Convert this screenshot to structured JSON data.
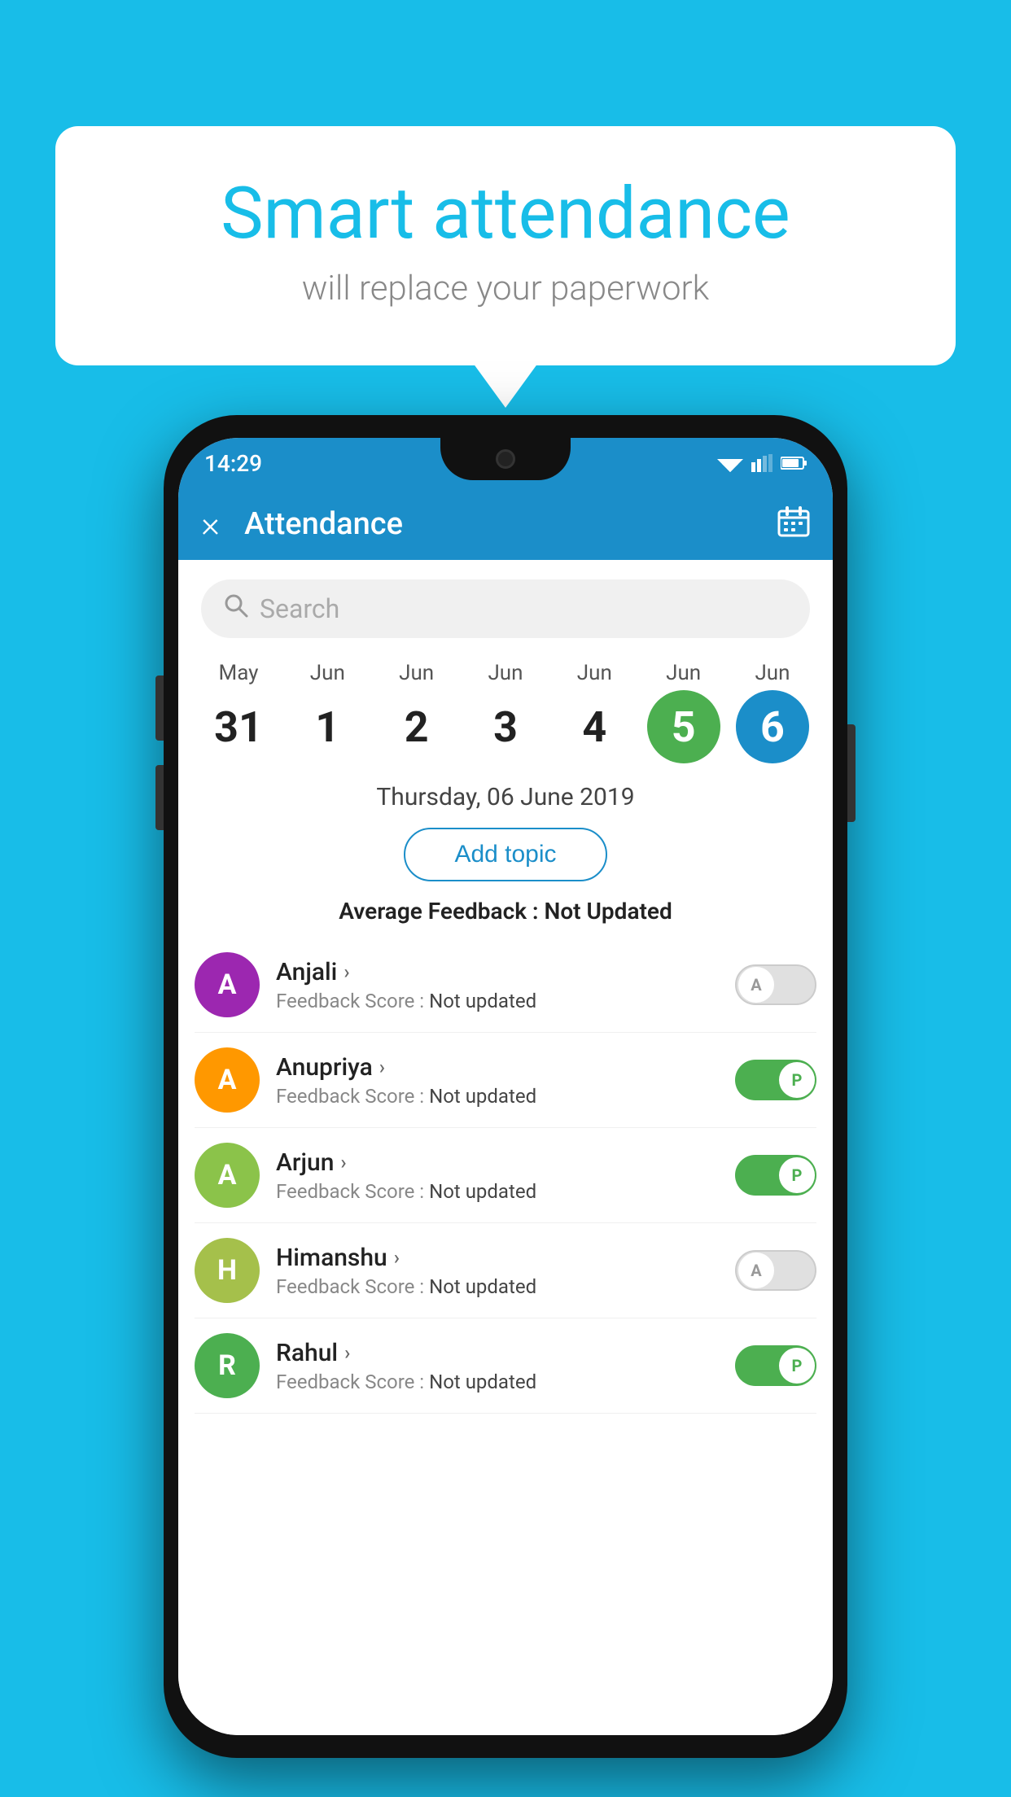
{
  "background": {
    "color": "#18bde8"
  },
  "speech_bubble": {
    "title": "Smart attendance",
    "subtitle": "will replace your paperwork"
  },
  "status_bar": {
    "time": "14:29"
  },
  "app_bar": {
    "title": "Attendance",
    "close_label": "×",
    "calendar_label": "📅"
  },
  "search": {
    "placeholder": "Search"
  },
  "calendar": {
    "days": [
      {
        "month": "May",
        "num": "31",
        "state": "normal"
      },
      {
        "month": "Jun",
        "num": "1",
        "state": "normal"
      },
      {
        "month": "Jun",
        "num": "2",
        "state": "normal"
      },
      {
        "month": "Jun",
        "num": "3",
        "state": "normal"
      },
      {
        "month": "Jun",
        "num": "4",
        "state": "normal"
      },
      {
        "month": "Jun",
        "num": "5",
        "state": "today"
      },
      {
        "month": "Jun",
        "num": "6",
        "state": "selected"
      }
    ]
  },
  "date_header": "Thursday, 06 June 2019",
  "add_topic_label": "Add topic",
  "avg_feedback_label": "Average Feedback :",
  "avg_feedback_value": "Not Updated",
  "students": [
    {
      "name": "Anjali",
      "avatar_letter": "A",
      "avatar_color": "#9c27b0",
      "feedback_label": "Feedback Score :",
      "feedback_value": "Not updated",
      "toggle_state": "off",
      "toggle_letter": "A"
    },
    {
      "name": "Anupriya",
      "avatar_letter": "A",
      "avatar_color": "#ff9800",
      "feedback_label": "Feedback Score :",
      "feedback_value": "Not updated",
      "toggle_state": "on",
      "toggle_letter": "P"
    },
    {
      "name": "Arjun",
      "avatar_letter": "A",
      "avatar_color": "#8bc34a",
      "feedback_label": "Feedback Score :",
      "feedback_value": "Not updated",
      "toggle_state": "on",
      "toggle_letter": "P"
    },
    {
      "name": "Himanshu",
      "avatar_letter": "H",
      "avatar_color": "#a5c04b",
      "feedback_label": "Feedback Score :",
      "feedback_value": "Not updated",
      "toggle_state": "off",
      "toggle_letter": "A"
    },
    {
      "name": "Rahul",
      "avatar_letter": "R",
      "avatar_color": "#4caf50",
      "feedback_label": "Feedback Score :",
      "feedback_value": "Not updated",
      "toggle_state": "on",
      "toggle_letter": "P"
    }
  ]
}
